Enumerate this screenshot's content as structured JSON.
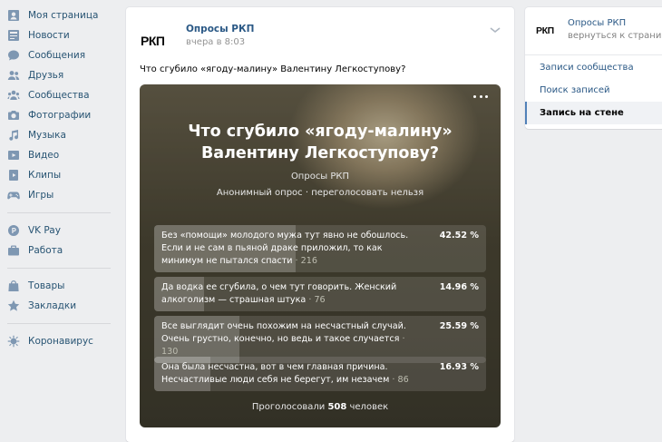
{
  "nav": [
    {
      "label": "Моя страница",
      "icon": "user-icon"
    },
    {
      "label": "Новости",
      "icon": "news-icon"
    },
    {
      "label": "Сообщения",
      "icon": "message-icon"
    },
    {
      "label": "Друзья",
      "icon": "friends-icon"
    },
    {
      "label": "Сообщества",
      "icon": "groups-icon"
    },
    {
      "label": "Фотографии",
      "icon": "camera-icon"
    },
    {
      "label": "Музыка",
      "icon": "music-icon"
    },
    {
      "label": "Видео",
      "icon": "video-icon"
    },
    {
      "label": "Клипы",
      "icon": "clips-icon"
    },
    {
      "label": "Игры",
      "icon": "gamepad-icon"
    },
    {
      "label": "VK Pay",
      "icon": "vkpay-icon"
    },
    {
      "label": "Работа",
      "icon": "briefcase-icon"
    },
    {
      "label": "Товары",
      "icon": "shopping-bag-icon"
    },
    {
      "label": "Закладки",
      "icon": "star-icon"
    },
    {
      "label": "Коронавирус",
      "icon": "virus-icon"
    }
  ],
  "post": {
    "logo_text": "РКП",
    "author": "Опросы РКП",
    "time": "вчера в 8:03",
    "text": "Что сгубило «ягоду-малину» Валентину Легкоступову?"
  },
  "poll": {
    "title": "Что сгубило «ягоду-малину» Валентину Легкоступову?",
    "owner": "Опросы РКП",
    "meta": "Анонимный опрос · переголосовать нельзя",
    "answers": [
      {
        "text": "Без «помощи» молодого мужа тут явно не обошлось. Если и не сам в пьяной драке приложил, то как минимум не пытался спасти",
        "count": "· 216",
        "percent": "42.52 %",
        "fraction": 0.4252
      },
      {
        "text": "Да водка ее сгубила, о чем тут говорить. Женский алкоголизм — страшная штука",
        "count": "· 76",
        "percent": "14.96 %",
        "fraction": 0.1496
      },
      {
        "text": "Все выглядит очень похожим на несчастный случай. Очень грустно, конечно, но ведь и такое случается",
        "count": "· 130",
        "percent": "25.59 %",
        "fraction": 0.2559
      },
      {
        "text": "Она была несчастна, вот в чем главная причина. Несчастливые люди себя не берегут, им незачем",
        "count": "· 86",
        "percent": "16.93 %",
        "fraction": 0.1693
      }
    ],
    "total_prefix": "Проголосовали",
    "total_count": "508",
    "total_suffix": "человек"
  },
  "card": {
    "logo_text": "РКП",
    "name": "Опросы РКП",
    "back": "вернуться к странице",
    "links": [
      {
        "label": "Записи сообщества",
        "active": false
      },
      {
        "label": "Поиск записей",
        "active": false
      },
      {
        "label": "Запись на стене",
        "active": true
      }
    ]
  },
  "colors": {
    "link": "#2a5885",
    "nav_text": "#285473",
    "nav_icon": "#7e97b2",
    "background": "#edeef0"
  }
}
